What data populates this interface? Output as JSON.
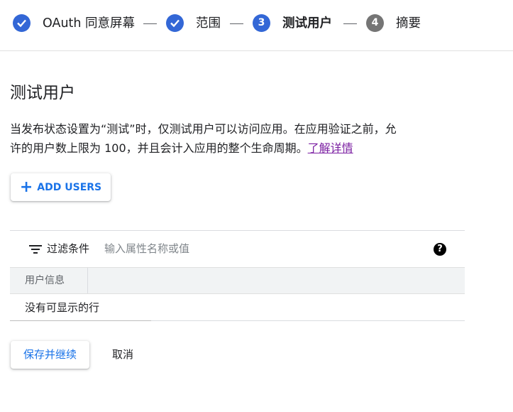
{
  "stepper": {
    "steps": [
      {
        "label": "OAuth 同意屏幕",
        "state": "complete"
      },
      {
        "label": "范围",
        "state": "complete"
      },
      {
        "number": "3",
        "label": "测试用户",
        "state": "active"
      },
      {
        "number": "4",
        "label": "摘要",
        "state": "pending"
      }
    ]
  },
  "page": {
    "title": "测试用户",
    "description_line1": "当发布状态设置为“测试”时，仅测试用户可以访问应用。在应用验证之前，允",
    "description_line2": "许的用户数上限为 100，并且会计入应用的整个生命周期。",
    "learn_more": "了解详情"
  },
  "add_users_button": {
    "label": "ADD USERS",
    "icon": "plus-icon"
  },
  "filter": {
    "icon": "filter-icon",
    "label": "过滤条件",
    "placeholder": "输入属性名称或值",
    "help_icon": "help-icon"
  },
  "table": {
    "columns": [
      "用户信息"
    ],
    "empty_message": "没有可显示的行"
  },
  "actions": {
    "save_label": "保存并继续",
    "cancel_label": "取消"
  },
  "colors": {
    "accent": "#1a73e8",
    "step_complete": "#3367d6",
    "step_pending": "#757575",
    "link_visited": "#7b1fa2"
  }
}
